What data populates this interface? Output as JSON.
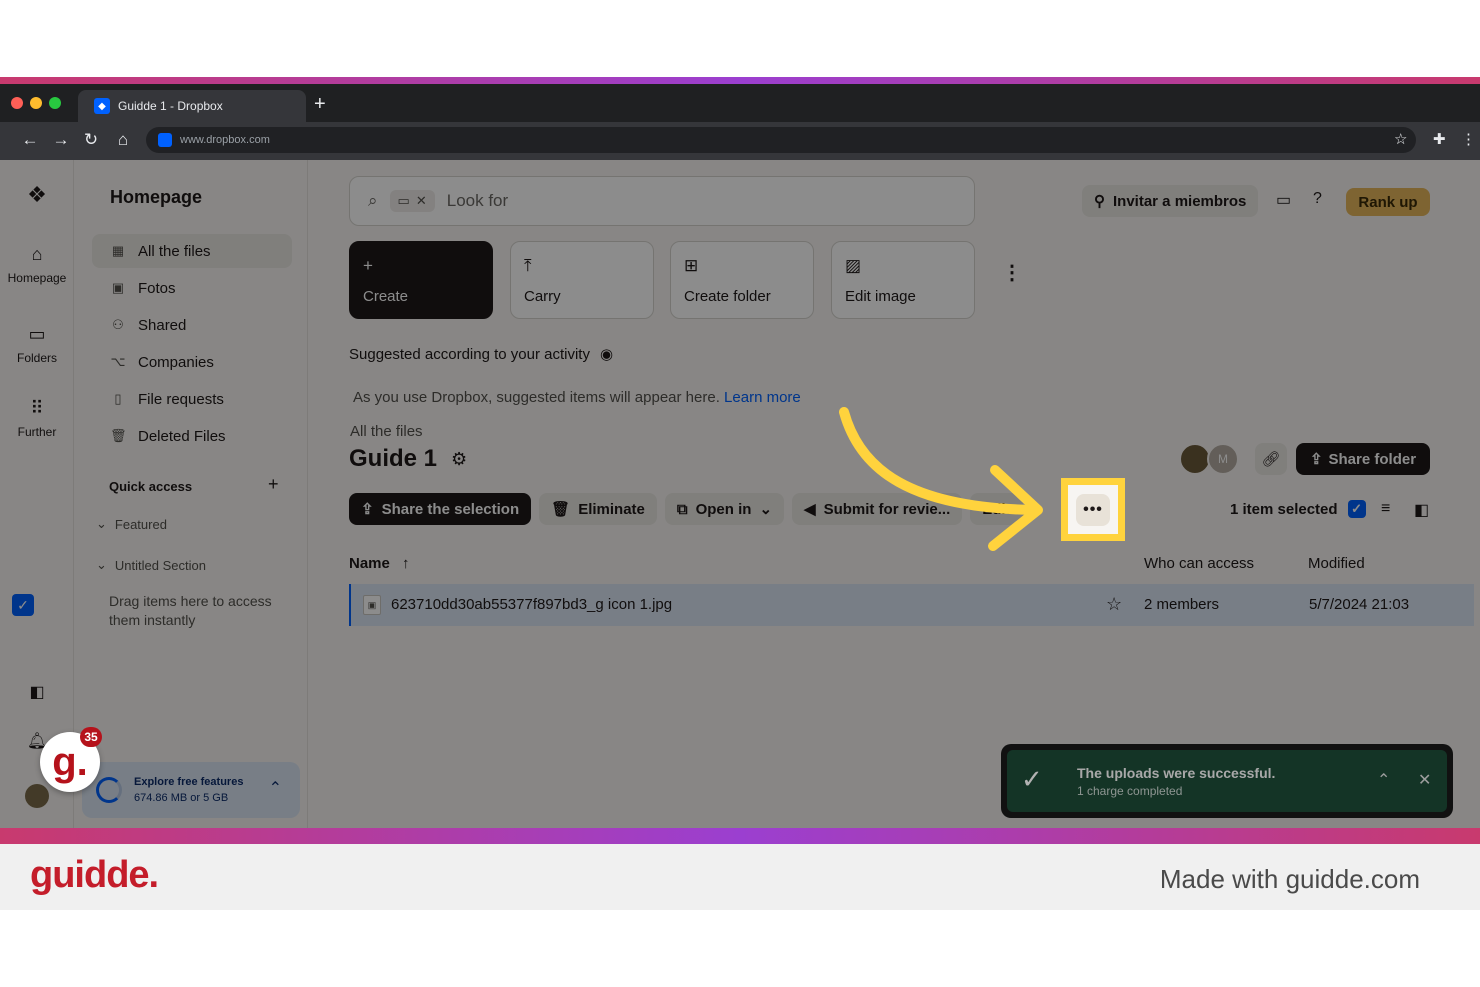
{
  "browser": {
    "tab_title": "Guidde 1 - Dropbox",
    "url": "www.dropbox.com"
  },
  "rail": {
    "items": [
      {
        "label": "Homepage",
        "icon": "home-icon"
      },
      {
        "label": "Folders",
        "icon": "folder-icon"
      },
      {
        "label": "Further",
        "icon": "grid-icon"
      }
    ]
  },
  "sidebar": {
    "title": "Homepage",
    "items": [
      {
        "label": "All the files",
        "icon": "files-icon"
      },
      {
        "label": "Fotos",
        "icon": "photo-icon"
      },
      {
        "label": "Shared",
        "icon": "shared-icon"
      },
      {
        "label": "Companies",
        "icon": "companies-icon"
      },
      {
        "label": "File requests",
        "icon": "file-request-icon"
      },
      {
        "label": "Deleted Files",
        "icon": "trash-icon"
      }
    ],
    "quick_access": "Quick access",
    "featured": "Featured",
    "untitled_section": "Untitled Section",
    "hint": "Drag items here to access them instantly",
    "storage_title": "Explore free features",
    "storage_usage": "674.86 MB or 5 GB"
  },
  "header": {
    "search_placeholder": "Look for",
    "invite_label": "Invitar a miembros",
    "rank_up_label": "Rank up"
  },
  "actions": [
    {
      "label": "Create",
      "icon": "plus-icon"
    },
    {
      "label": "Carry",
      "icon": "upload-icon"
    },
    {
      "label": "Create folder",
      "icon": "new-folder-icon"
    },
    {
      "label": "Edit image",
      "icon": "edit-image-icon"
    }
  ],
  "suggested": {
    "heading": "Suggested according to your activity",
    "info": "As you use Dropbox, suggested items will appear here.",
    "learn_more": "Learn more"
  },
  "folder": {
    "breadcrumb": "All the files",
    "title": "Guide 1",
    "avatar_initial": "M",
    "share_folder_label": "Share folder"
  },
  "selection_bar": {
    "share_selection": "Share the selection",
    "eliminate": "Eliminate",
    "open_in": "Open in",
    "submit_review": "Submit for revie...",
    "edit": "Edit",
    "more": "•••",
    "selected_count": "1 item selected"
  },
  "table": {
    "headers": {
      "name": "Name",
      "access": "Who can access",
      "modified": "Modified"
    },
    "rows": [
      {
        "name": "623710dd30ab55377f897bd3_g icon 1.jpg",
        "access": "2 members",
        "modified": "5/7/2024 21:03"
      }
    ]
  },
  "toast": {
    "title": "The uploads were successful.",
    "subtitle": "1 charge completed"
  },
  "guidde": {
    "badge_count": "35",
    "logo": "guidde.",
    "made_with": "Made with guidde.com"
  },
  "colors": {
    "highlight": "#ffd33d",
    "dropbox_blue": "#0061fe",
    "brand_red": "#c41d2a"
  }
}
